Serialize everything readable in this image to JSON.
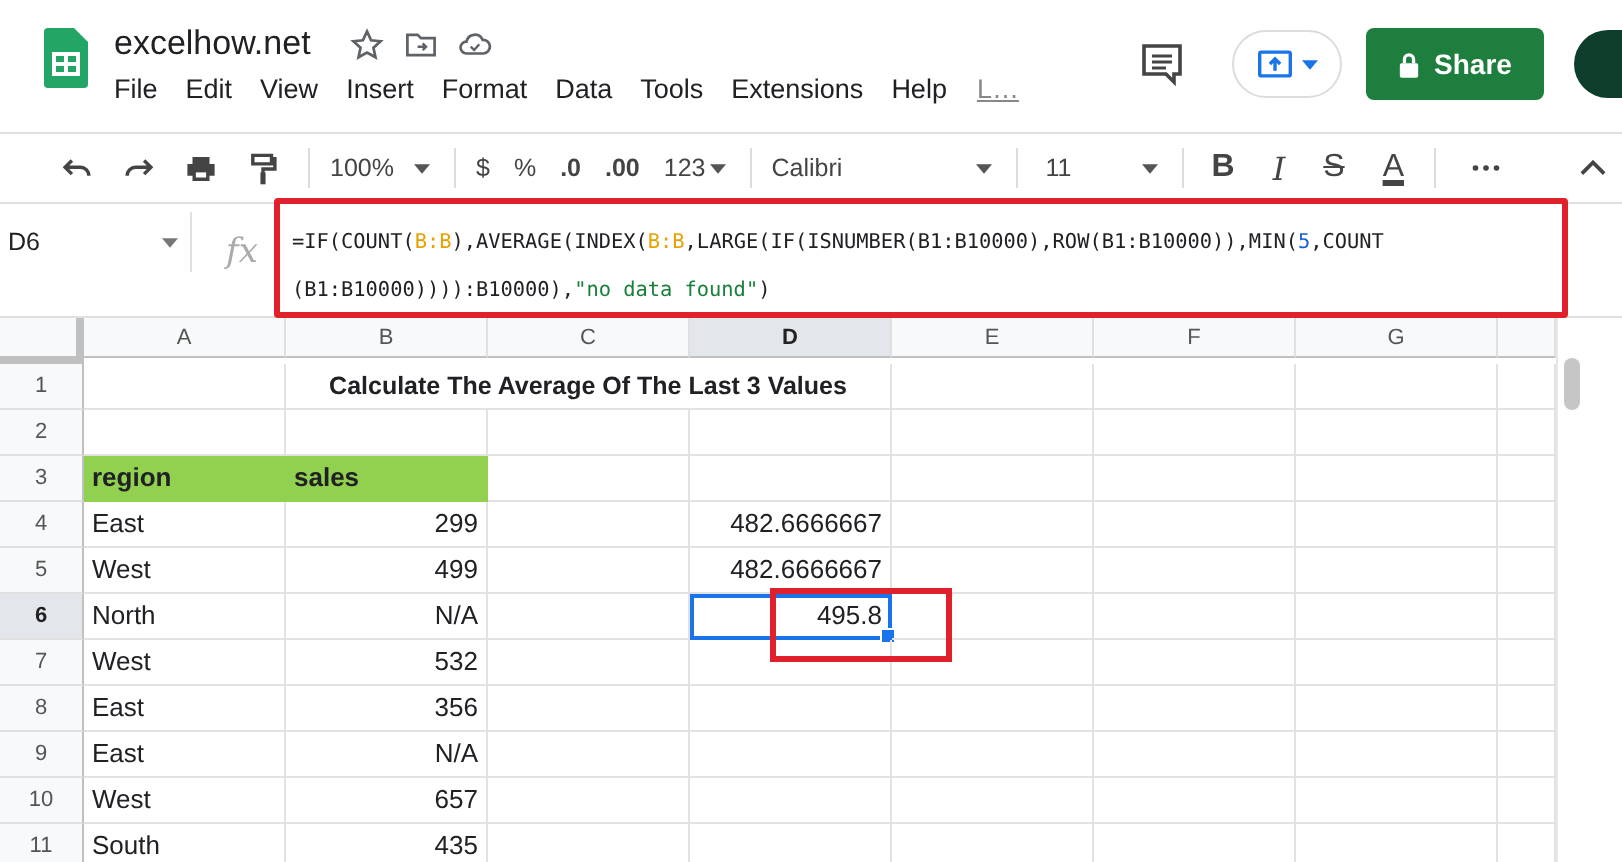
{
  "document": {
    "title": "excelhow.net",
    "menu": [
      "File",
      "Edit",
      "View",
      "Insert",
      "Format",
      "Data",
      "Tools",
      "Extensions",
      "Help"
    ],
    "last_edit": "L…",
    "share_label": "Share"
  },
  "toolbar": {
    "zoom": "100%",
    "currency": "$",
    "percent": "%",
    "decrease_decimals": ".0",
    "increase_decimals": ".00",
    "more_formats": "123",
    "font": "Calibri",
    "font_size": "11",
    "bold": "B",
    "italic": "I",
    "strikethrough": "S",
    "text_color": "A"
  },
  "formula_bar": {
    "name_box": "D6",
    "fx": "fx",
    "lines": [
      [
        {
          "kind": "plain",
          "text": "=IF(COUNT("
        },
        {
          "kind": "range",
          "text": "B:B"
        },
        {
          "kind": "plain",
          "text": "),AVERAGE(INDEX("
        },
        {
          "kind": "range",
          "text": "B:B"
        },
        {
          "kind": "plain",
          "text": ",LARGE(IF(ISNUMBER(B1:B10000),ROW(B1:B10000)),MIN("
        },
        {
          "kind": "number",
          "text": "5"
        },
        {
          "kind": "plain",
          "text": ",COUNT"
        }
      ],
      [
        {
          "kind": "plain",
          "text": "(B1:B10000)))):B10000),"
        },
        {
          "kind": "string",
          "text": "\"no data found\""
        },
        {
          "kind": "plain",
          "text": ")"
        }
      ]
    ]
  },
  "sheet": {
    "columns": [
      {
        "label": "A",
        "selected": false
      },
      {
        "label": "B",
        "selected": false
      },
      {
        "label": "C",
        "selected": false
      },
      {
        "label": "D",
        "selected": true
      },
      {
        "label": "E",
        "selected": false
      },
      {
        "label": "F",
        "selected": false
      },
      {
        "label": "G",
        "selected": false
      }
    ],
    "rows": [
      {
        "label": "1",
        "selected": false,
        "cells": [
          {
            "selected": false
          },
          {
            "kind": "title",
            "text": "Calculate The Average Of The Last 3 Values",
            "selected": false
          },
          {
            "selected": false
          },
          {
            "selected": false
          },
          {
            "selected": false
          }
        ]
      },
      {
        "label": "2",
        "selected": false,
        "cells": [
          {
            "selected": false
          },
          {
            "selected": false
          },
          {
            "selected": false
          },
          {
            "selected": false
          },
          {
            "selected": false
          },
          {
            "selected": false
          },
          {
            "selected": false
          }
        ]
      },
      {
        "label": "3",
        "selected": false,
        "cells": [
          {
            "kind": "header",
            "text": "region",
            "selected": false
          },
          {
            "kind": "header",
            "text": "sales",
            "selected": false
          },
          {
            "selected": false
          },
          {
            "selected": false
          },
          {
            "selected": false
          },
          {
            "selected": false
          },
          {
            "selected": false
          }
        ]
      },
      {
        "label": "4",
        "selected": false,
        "cells": [
          {
            "kind": "text",
            "text": "East",
            "selected": false
          },
          {
            "kind": "number",
            "text": "299",
            "selected": false
          },
          {
            "selected": false
          },
          {
            "kind": "number",
            "text": "482.6666667",
            "selected": false
          },
          {
            "selected": false
          },
          {
            "selected": false
          },
          {
            "selected": false
          }
        ]
      },
      {
        "label": "5",
        "selected": false,
        "cells": [
          {
            "kind": "text",
            "text": "West",
            "selected": false
          },
          {
            "kind": "number",
            "text": "499",
            "selected": false
          },
          {
            "selected": false
          },
          {
            "kind": "number",
            "text": "482.6666667",
            "selected": false
          },
          {
            "selected": false
          },
          {
            "selected": false
          },
          {
            "selected": false
          }
        ]
      },
      {
        "label": "6",
        "selected": true,
        "cells": [
          {
            "kind": "text",
            "text": "North",
            "selected": false
          },
          {
            "kind": "number",
            "text": "N/A",
            "selected": false
          },
          {
            "selected": false
          },
          {
            "kind": "number",
            "text": "495.8",
            "selected": true
          },
          {
            "selected": false
          },
          {
            "selected": false
          },
          {
            "selected": false
          }
        ]
      },
      {
        "label": "7",
        "selected": false,
        "cells": [
          {
            "kind": "text",
            "text": "West",
            "selected": false
          },
          {
            "kind": "number",
            "text": "532",
            "selected": false
          },
          {
            "selected": false
          },
          {
            "selected": false
          },
          {
            "selected": false
          },
          {
            "selected": false
          },
          {
            "selected": false
          }
        ]
      },
      {
        "label": "8",
        "selected": false,
        "cells": [
          {
            "kind": "text",
            "text": "East",
            "selected": false
          },
          {
            "kind": "number",
            "text": "356",
            "selected": false
          },
          {
            "selected": false
          },
          {
            "selected": false
          },
          {
            "selected": false
          },
          {
            "selected": false
          },
          {
            "selected": false
          }
        ]
      },
      {
        "label": "9",
        "selected": false,
        "cells": [
          {
            "kind": "text",
            "text": "East",
            "selected": false
          },
          {
            "kind": "number",
            "text": "N/A",
            "selected": false
          },
          {
            "selected": false
          },
          {
            "selected": false
          },
          {
            "selected": false
          },
          {
            "selected": false
          },
          {
            "selected": false
          }
        ]
      },
      {
        "label": "10",
        "selected": false,
        "cells": [
          {
            "kind": "text",
            "text": "West",
            "selected": false
          },
          {
            "kind": "number",
            "text": "657",
            "selected": false
          },
          {
            "selected": false
          },
          {
            "selected": false
          },
          {
            "selected": false
          },
          {
            "selected": false
          },
          {
            "selected": false
          }
        ]
      },
      {
        "label": "11",
        "selected": false,
        "cells": [
          {
            "kind": "text",
            "text": "South",
            "selected": false
          },
          {
            "kind": "number",
            "text": "435",
            "selected": false
          },
          {
            "selected": false
          },
          {
            "selected": false
          },
          {
            "selected": false
          },
          {
            "selected": false
          },
          {
            "selected": false
          }
        ]
      }
    ]
  }
}
